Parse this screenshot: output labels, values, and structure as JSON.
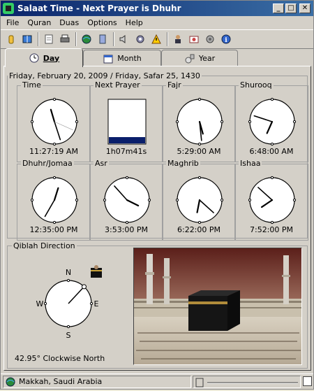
{
  "window": {
    "title": "Salaat Time - Next Prayer is Dhuhr",
    "min_icon": "minimize-icon",
    "max_icon": "maximize-icon",
    "close_icon": "close-icon"
  },
  "menu": [
    "File",
    "Quran",
    "Duas",
    "Options",
    "Help"
  ],
  "toolbar": [
    "hand-icon",
    "book-icon",
    "document-icon",
    "printer-icon",
    "globe-icon",
    "scroll-icon",
    "speaker-icon",
    "gear-icon",
    "warning-icon",
    "person-icon",
    "photo-icon",
    "sound-icon",
    "info-icon"
  ],
  "tabs": [
    {
      "label": "Day",
      "icon": "clock-icon"
    },
    {
      "label": "Month",
      "icon": "calendar-icon"
    },
    {
      "label": "Year",
      "icon": "year-icon"
    }
  ],
  "date": "Friday, February 20, 2009 / Friday, Safar 25, 1430",
  "clocks": [
    {
      "label": "Time",
      "time": "11:27:19 AM",
      "h": 11,
      "m": 27,
      "s": 19
    },
    {
      "label": "Next Prayer",
      "time": "1h07m41s",
      "progress": 0.15
    },
    {
      "label": "Fajr",
      "time": "5:29:00 AM",
      "h": 5,
      "m": 29
    },
    {
      "label": "Shurooq",
      "time": "6:48:00 AM",
      "h": 6,
      "m": 48
    },
    {
      "label": "Dhuhr/Jomaa",
      "time": "12:35:00 PM",
      "h": 12,
      "m": 35
    },
    {
      "label": "Asr",
      "time": "3:53:00 PM",
      "h": 3,
      "m": 53
    },
    {
      "label": "Maghrib",
      "time": "6:22:00 PM",
      "h": 6,
      "m": 22
    },
    {
      "label": "Ishaa",
      "time": "7:52:00 PM",
      "h": 7,
      "m": 52
    }
  ],
  "qiblah": {
    "label": "Qiblah Direction",
    "degrees": 42.95,
    "text": "42.95° Clockwise North",
    "n": "N",
    "s": "S",
    "e": "E",
    "w": "W"
  },
  "status": {
    "location": "Makkah, Saudi Arabia"
  },
  "colors": {
    "progress_fill": "#0a1f6b",
    "title_start": "#0a246a",
    "title_end": "#3a6ea5"
  }
}
